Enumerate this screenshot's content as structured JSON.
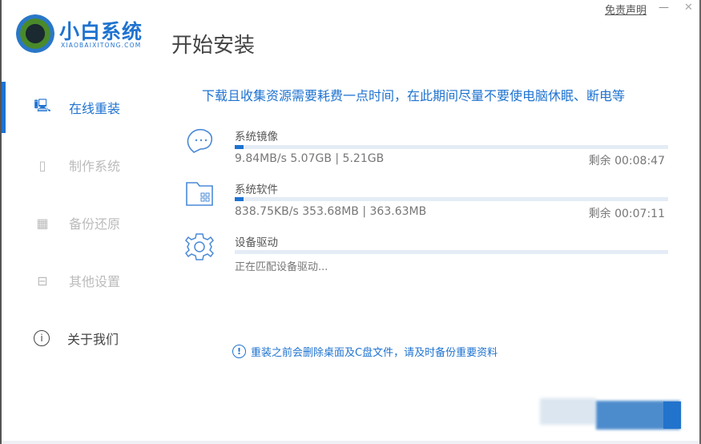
{
  "app": {
    "brand": "小白系统",
    "brand_sub": "XIAOBAIXITONG.COM",
    "title": "开始安装",
    "disclaimer": "免责声明",
    "minimize": "—",
    "close": "✕"
  },
  "sidebar": {
    "items": [
      {
        "label": "在线重装",
        "icon": "monitor-icon",
        "active": true
      },
      {
        "label": "制作系统",
        "icon": "usb-icon"
      },
      {
        "label": "备份还原",
        "icon": "backup-icon"
      },
      {
        "label": "其他设置",
        "icon": "briefcase-icon"
      },
      {
        "label": "关于我们",
        "icon": "info-icon"
      }
    ]
  },
  "main": {
    "notice": "下载且收集资源需要耗费一点时间，在此期间尽量不要使电脑休眠、断电等",
    "items": [
      {
        "title": "系统镜像",
        "stat": "9.84MB/s 5.07GB | 5.21GB",
        "remain": "剩余 00:08:47",
        "progress": 0.02,
        "icon": "chat-bubble-icon"
      },
      {
        "title": "系统软件",
        "stat": "838.75KB/s 353.68MB | 363.63MB",
        "remain": "剩余 00:07:11",
        "progress": 0.02,
        "icon": "folder-apps-icon"
      },
      {
        "title": "设备驱动",
        "stat": "正在匹配设备驱动...",
        "progress": 0,
        "icon": "gear-icon"
      }
    ],
    "warning": "重装之前会删除桌面及C盘文件，请及时备份重要资料"
  },
  "colors": {
    "accent": "#1f73d0"
  }
}
